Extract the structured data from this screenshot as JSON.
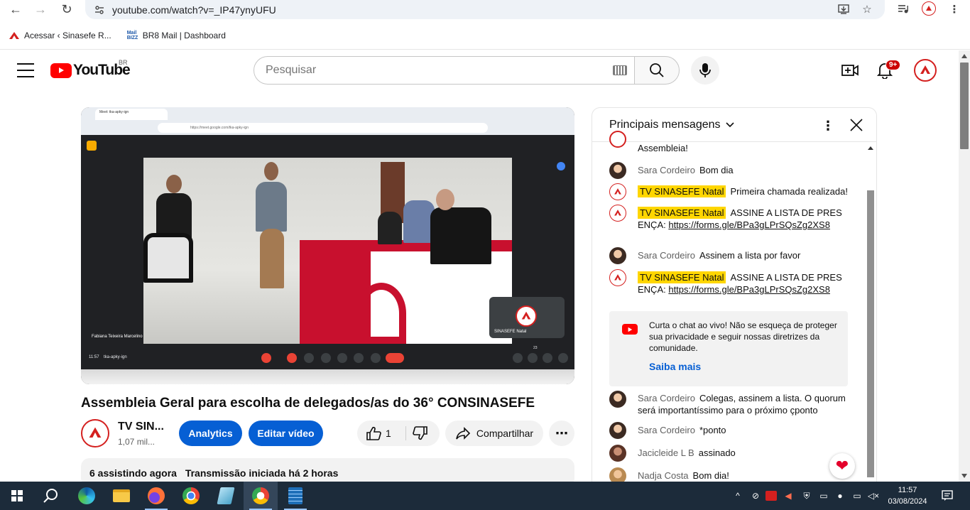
{
  "browser": {
    "url": "youtube.com/watch?v=_IP47ynyUFU",
    "bookmarks": [
      {
        "label": "Acessar ‹ Sinasefe R..."
      },
      {
        "label": "BR8 Mail | Dashboard",
        "icon_text": "Mail BIZZ"
      }
    ]
  },
  "youtube": {
    "logo_text": "YouTube",
    "country": "BR",
    "search_placeholder": "Pesquisar",
    "notification_count": "9+"
  },
  "video_content": {
    "tab_title": "Meet: tka-apky-ign",
    "omnibox_url": "https://meet.google.com/tka-apky-ign",
    "participant_label": "Fabiana Teixeira Marcelino",
    "self_view_name": "SINASEFE Natal",
    "meeting_time": "11:57",
    "meeting_code": "tka-apky-ign",
    "participants_count": "23"
  },
  "video": {
    "title": "Assembleia Geral para escolha de delegados/as do 36° CONSINASEFE",
    "channel_name": "TV SIN...",
    "subscribers": "1,07 mil...",
    "analytics_label": "Analytics",
    "edit_label": "Editar vídeo",
    "like_count": "1",
    "share_label": "Compartilhar",
    "viewers": "6 assistindo agora",
    "stream_started": "Transmissão iniciada há 2 horas"
  },
  "chat": {
    "title": "Principais mensagens",
    "messages": [
      {
        "author": "",
        "text": "Assembleia!",
        "owner": false
      },
      {
        "author": "Sara Cordeiro",
        "text": "Bom dia",
        "owner": false
      },
      {
        "author": "TV SINASEFE Natal",
        "text": "Primeira chamada realizada!",
        "owner": true
      },
      {
        "author": "TV SINASEFE Natal",
        "text": "ASSINE A LISTA DE PRESENÇA: ",
        "link": "https://forms.gle/BPa3gLPrSQsZg2XS8",
        "owner": true
      },
      {
        "author": "Sara Cordeiro",
        "text": "Assinem a lista por favor",
        "owner": false
      },
      {
        "author": "TV SINASEFE Natal",
        "text": "ASSINE A LISTA DE PRESENÇA: ",
        "link": "https://forms.gle/BPa3gLPrSQsZg2XS8",
        "owner": true
      },
      {
        "author": "Sara Cordeiro",
        "text": "Colegas, assinem a lista. O quorum será importantíssimo para o próximo çponto",
        "owner": false
      },
      {
        "author": "Sara Cordeiro",
        "text": "*ponto",
        "owner": false
      },
      {
        "author": "Jacicleide L B",
        "text": "assinado",
        "owner": false
      },
      {
        "author": "Nadja Costa",
        "text": "Bom dia!",
        "owner": false
      }
    ],
    "notice_text": "Curta o chat ao vivo! Não se esqueça de proteger sua privacidade e seguir nossas diretrizes da comunidade.",
    "notice_link": "Saiba mais"
  },
  "taskbar": {
    "time": "11:57",
    "date": "03/08/2024"
  },
  "colors": {
    "yt_red": "#ff0000",
    "blue_button": "#065fd4",
    "owner_badge": "#ffd600",
    "sinasefe_red": "#d4201f"
  }
}
